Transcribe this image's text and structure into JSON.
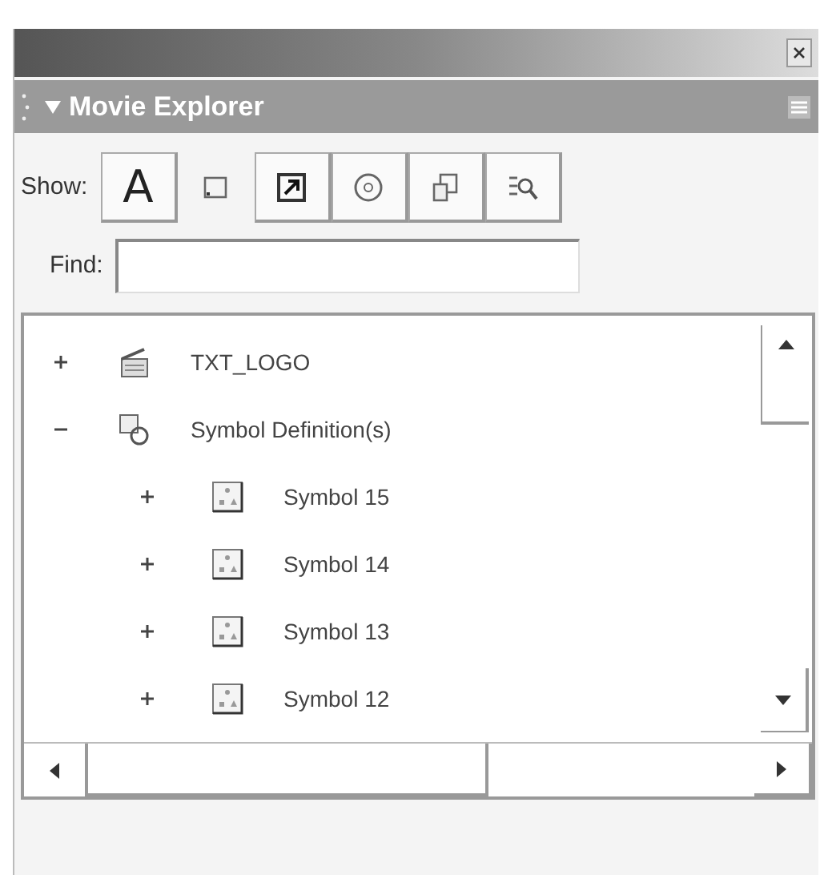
{
  "panel": {
    "title": "Movie Explorer",
    "expanded": true
  },
  "show": {
    "label": "Show:",
    "filters": [
      {
        "kind": "text",
        "label": "A",
        "selected": true
      },
      {
        "kind": "box",
        "selected": false
      },
      {
        "kind": "arrow",
        "selected": true
      },
      {
        "kind": "disc",
        "selected": true
      },
      {
        "kind": "pages",
        "selected": true
      },
      {
        "kind": "magnifier",
        "selected": true
      }
    ]
  },
  "find": {
    "label": "Find:"
  },
  "tree": [
    {
      "label": "TXT_LOGO",
      "kind": "scene",
      "expanded": false
    },
    {
      "label": "Symbol Definition(s)",
      "kind": "definitions",
      "expanded": true,
      "children": [
        {
          "label": "Symbol 15",
          "kind": "symbol",
          "expanded": false
        },
        {
          "label": "Symbol 14",
          "kind": "symbol",
          "expanded": false
        },
        {
          "label": "Symbol 13",
          "kind": "symbol",
          "expanded": false
        },
        {
          "label": "Symbol 12",
          "kind": "symbol",
          "expanded": false
        }
      ]
    }
  ]
}
